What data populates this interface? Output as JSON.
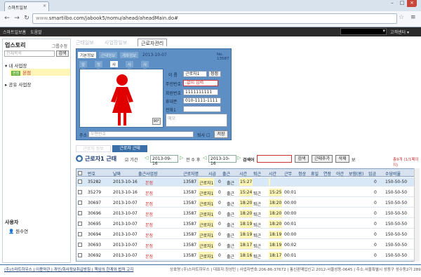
{
  "browser": {
    "tab_title": "스마트일보",
    "url_prefix": "www.",
    "url": "smartilbo.com/jabook5/nomu/ahead/aheadMain.do#"
  },
  "site": {
    "nav": [
      "스마트일보홈",
      "도움말"
    ],
    "customer_center": "고객센터 ▾"
  },
  "sidebar": {
    "title": "업스토리",
    "logout": "그룹수정",
    "search_placeholder": "전체목록",
    "search_button": "검색",
    "tree": {
      "my_workplace": "내 사업장",
      "selected_badge": "본점",
      "selected_label": "본점",
      "shared": "공유 사업장"
    },
    "user_section": "사용자",
    "user_name": "원수연"
  },
  "page_tabs": [
    "근태일보",
    "사업장일보",
    "근로자관리"
  ],
  "card": {
    "tabs": [
      "기본정보",
      "근태정보",
      "계좌정보"
    ],
    "date": "2013-10-07",
    "no": "No. 13587",
    "photo_tabs": [
      "앞면",
      "뒷면",
      "사진1",
      "사진2",
      "사진3"
    ],
    "rotate": "90°",
    "name_label": "이  름",
    "name_value": "근로자1",
    "name_extra": "정정",
    "rrn_label": "주민번호",
    "rrn_placeholder": "-없이 입력",
    "member_label": "회원번호",
    "member_value": "1111111111",
    "mobile_label": "휴대폰",
    "mobile_value": "010-1111-1111",
    "phone_label": "전화1",
    "dept_label": "소  속",
    "memo_placeholder": "메모",
    "addr_label": "주소",
    "addr_placeholder": "우편번호",
    "resign_label": "퇴사",
    "save_label": "저장"
  },
  "work": {
    "tabs": [
      "근로자 정보",
      "근로자 근태"
    ],
    "title": "근로자1 근태",
    "filter_label": "기간",
    "date_from": "2013-09-16",
    "date_mid_label": "전 수 후",
    "date_to": "2013-10-16",
    "search_label": "검색어",
    "search_btn": "검색",
    "print_btn": "근태추가",
    "delete_btn": "삭제",
    "extra": "보",
    "count": "총9개 (1/1페이지)"
  },
  "table": {
    "headers": [
      "번호",
      "날짜",
      "출근사업장",
      "근로자명",
      "시급",
      "출근",
      "시간",
      "퇴근",
      "시간",
      "근무",
      "정상",
      "휴일",
      "연장",
      "야간",
      "보험(원)",
      "임금",
      "수당비율"
    ],
    "rows": [
      [
        "35282",
        "2013-10-16",
        "본점",
        "13587",
        "근로자1",
        "0",
        "출근",
        "15:27",
        "",
        "",
        "",
        "",
        "",
        "",
        "",
        "",
        "0",
        "150-50-50"
      ],
      [
        "35279",
        "2013-10-16",
        "본점",
        "13587",
        "근로자1",
        "0",
        "출근",
        "15:24",
        "퇴근",
        "15:25",
        "00:01",
        "",
        "",
        "",
        "",
        "",
        "0",
        "150-50-50"
      ],
      [
        "30697",
        "2013-10-07",
        "본점",
        "13587",
        "근로자1",
        "0",
        "출근",
        "18:20",
        "퇴근",
        "18:20",
        "00:00",
        "",
        "",
        "",
        "",
        "",
        "0",
        "150-50-50"
      ],
      [
        "30696",
        "2013-10-07",
        "본점",
        "13587",
        "근로자1",
        "0",
        "출근",
        "18:20",
        "퇴근",
        "18:20",
        "00:00",
        "",
        "",
        "",
        "",
        "",
        "0",
        "150-50-50"
      ],
      [
        "30695",
        "2013-10-07",
        "본점",
        "13587",
        "근로자1",
        "0",
        "출근",
        "18:19",
        "퇴근",
        "18:20",
        "00:01",
        "",
        "",
        "",
        "",
        "",
        "0",
        "150-50-50"
      ],
      [
        "30694",
        "2013-10-07",
        "본점",
        "13587",
        "근로자1",
        "0",
        "출근",
        "18:19",
        "퇴근",
        "18:19",
        "00:00",
        "",
        "",
        "",
        "",
        "",
        "0",
        "150-50-50"
      ],
      [
        "30693",
        "2013-10-07",
        "본점",
        "13587",
        "근로자1",
        "0",
        "출근",
        "18:17",
        "퇴근",
        "18:19",
        "00:02",
        "",
        "",
        "",
        "",
        "",
        "0",
        "150-50-50"
      ],
      [
        "30692",
        "2013-10-07",
        "본점",
        "13587",
        "근로자1",
        "0",
        "출근",
        "18:16",
        "퇴근",
        "18:17",
        "00:01",
        "",
        "",
        "",
        "",
        "",
        "0",
        "150-50-50"
      ]
    ]
  },
  "footer": {
    "links": "(주)스마트하우스 | 이용약관 | 개인/회사정보취급방침 | 책임의 한계와 법적 고지",
    "info": "상호명 (주)스마트하우스 | 대표자:정성민 | 사업자번호:206-86-37672 | 통신판매업신고 2012-서울성동-0645 | 주소:서울특별시 성동구 성수동2가 289"
  }
}
